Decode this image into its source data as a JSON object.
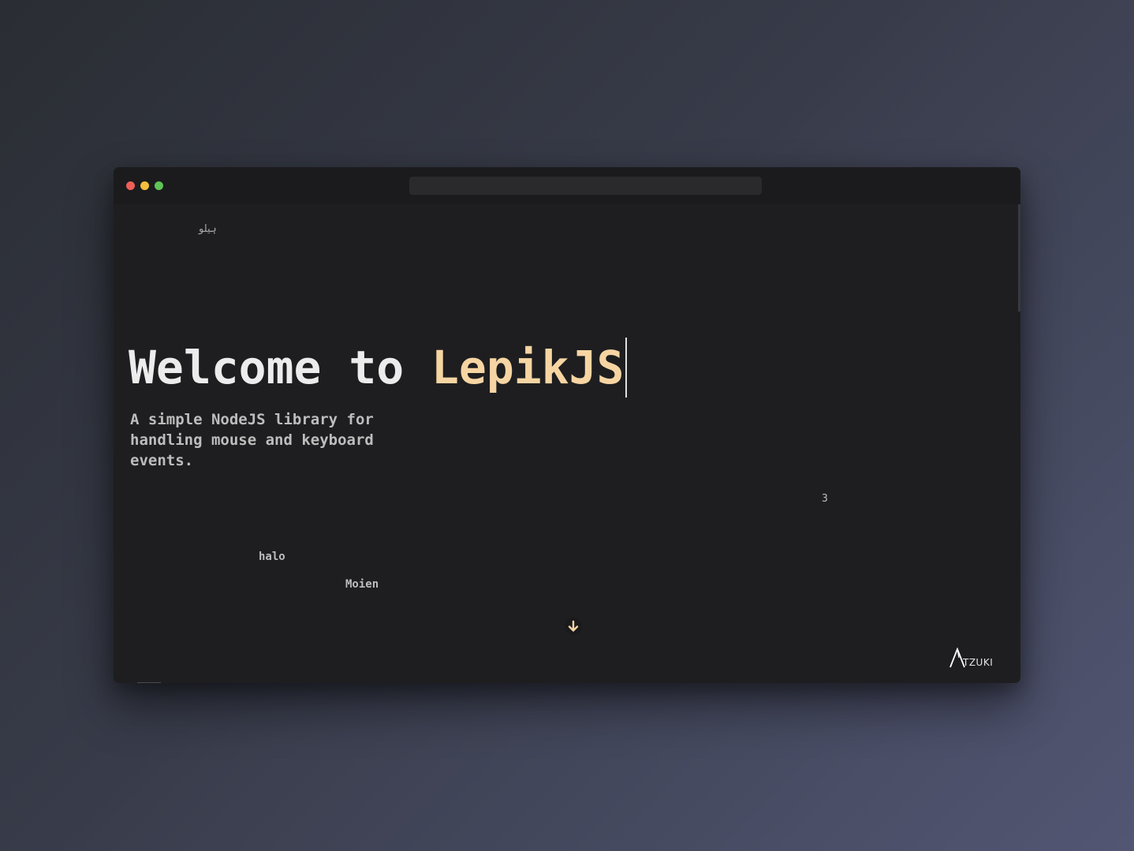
{
  "window": {
    "traffic_lights": {
      "close_color": "#ee5f57",
      "minimize_color": "#f5be3c",
      "maximize_color": "#5fc455"
    }
  },
  "page": {
    "floating_words": {
      "hello_arabic": "ہیلو",
      "three": "3",
      "halo": "halo",
      "moien": "Moien"
    },
    "headline": {
      "prefix": "Welcome to",
      "accent": "LepikJS",
      "accent_color": "#f6d5a3"
    },
    "subtitle": "A simple NodeJS library for handling mouse and keyboard events.",
    "scroll_icon": "arrow-down-icon",
    "logo": {
      "text": "TZUKI"
    }
  }
}
